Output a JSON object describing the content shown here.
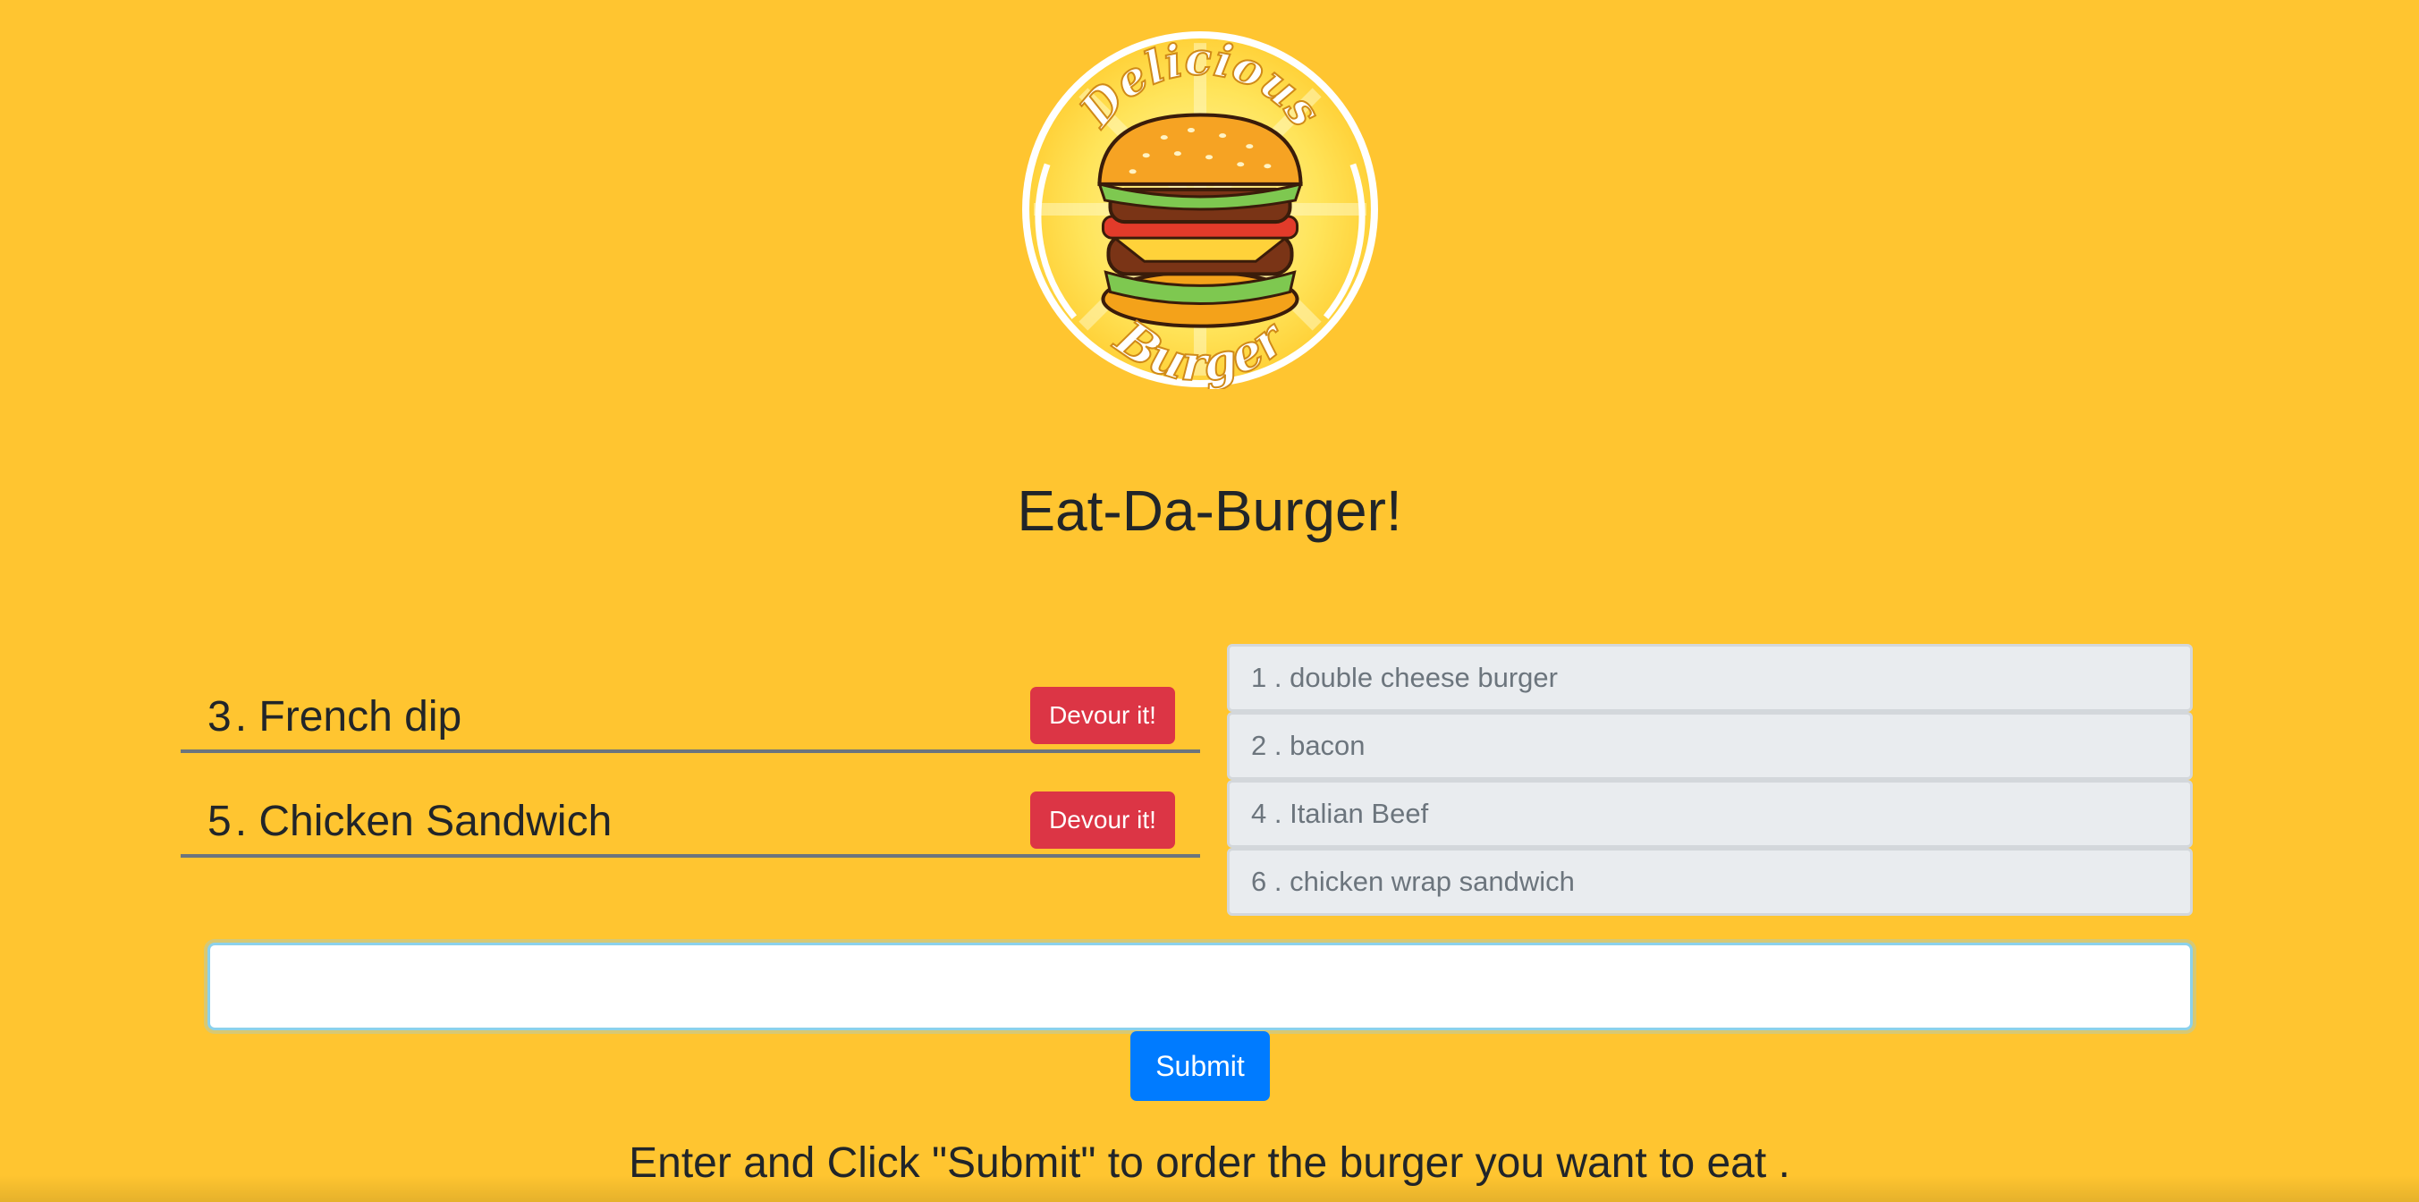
{
  "app": {
    "title": "Eat-Da-Burger!",
    "logo": {
      "icon": "burger-logo-icon",
      "top_text": "Delicious",
      "bottom_text": "Burger"
    }
  },
  "uneaten": [
    {
      "id": "3",
      "sep": ".",
      "name": "French dip",
      "button_label": "Devour it!"
    },
    {
      "id": "5",
      "sep": ".",
      "name": "Chicken Sandwich",
      "button_label": "Devour it!"
    }
  ],
  "devoured": [
    {
      "label": "1 . double cheese burger"
    },
    {
      "label": "2 . bacon"
    },
    {
      "label": "4 . Italian Beef"
    },
    {
      "label": "6 . chicken wrap sandwich"
    }
  ],
  "form": {
    "input_value": "",
    "submit_label": "Submit"
  },
  "instructions": "Enter and Click \"Submit\" to order the burger you want to eat .",
  "colors": {
    "background": "#ffc530",
    "devour_button": "#dc3545",
    "submit_button": "#007bff",
    "list_item_bg": "#e9ecef"
  }
}
